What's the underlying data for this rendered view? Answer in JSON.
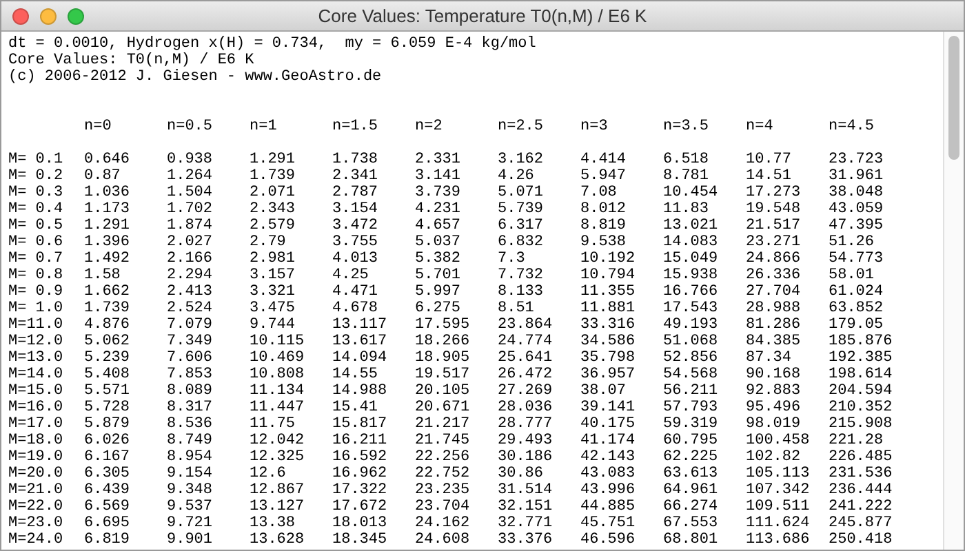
{
  "window": {
    "title": "Core Values: Temperature T0(n,M) / E6 K"
  },
  "header_lines": [
    "dt = 0.0010, Hydrogen x(H) = 0.734,  my = 6.059 E-4 kg/mol",
    "Core Values: T0(n,M) / E6 K",
    "(c) 2006-2012 J. Giesen - www.GeoAstro.de"
  ],
  "table": {
    "columns": [
      "n=0",
      "n=0.5",
      "n=1",
      "n=1.5",
      "n=2",
      "n=2.5",
      "n=3",
      "n=3.5",
      "n=4",
      "n=4.5"
    ],
    "rows": [
      {
        "label": "M= 0.1",
        "values": [
          "0.646",
          "0.938",
          "1.291",
          "1.738",
          "2.331",
          "3.162",
          "4.414",
          "6.518",
          "10.77",
          "23.723"
        ]
      },
      {
        "label": "M= 0.2",
        "values": [
          "0.87",
          "1.264",
          "1.739",
          "2.341",
          "3.141",
          "4.26",
          "5.947",
          "8.781",
          "14.51",
          "31.961"
        ]
      },
      {
        "label": "M= 0.3",
        "values": [
          "1.036",
          "1.504",
          "2.071",
          "2.787",
          "3.739",
          "5.071",
          "7.08",
          "10.454",
          "17.273",
          "38.048"
        ]
      },
      {
        "label": "M= 0.4",
        "values": [
          "1.173",
          "1.702",
          "2.343",
          "3.154",
          "4.231",
          "5.739",
          "8.012",
          "11.83",
          "19.548",
          "43.059"
        ]
      },
      {
        "label": "M= 0.5",
        "values": [
          "1.291",
          "1.874",
          "2.579",
          "3.472",
          "4.657",
          "6.317",
          "8.819",
          "13.021",
          "21.517",
          "47.395"
        ]
      },
      {
        "label": "M= 0.6",
        "values": [
          "1.396",
          "2.027",
          "2.79",
          "3.755",
          "5.037",
          "6.832",
          "9.538",
          "14.083",
          "23.271",
          "51.26"
        ]
      },
      {
        "label": "M= 0.7",
        "values": [
          "1.492",
          "2.166",
          "2.981",
          "4.013",
          "5.382",
          "7.3",
          "10.192",
          "15.049",
          "24.866",
          "54.773"
        ]
      },
      {
        "label": "M= 0.8",
        "values": [
          "1.58",
          "2.294",
          "3.157",
          "4.25",
          "5.701",
          "7.732",
          "10.794",
          "15.938",
          "26.336",
          "58.01"
        ]
      },
      {
        "label": "M= 0.9",
        "values": [
          "1.662",
          "2.413",
          "3.321",
          "4.471",
          "5.997",
          "8.133",
          "11.355",
          "16.766",
          "27.704",
          "61.024"
        ]
      },
      {
        "label": "M= 1.0",
        "values": [
          "1.739",
          "2.524",
          "3.475",
          "4.678",
          "6.275",
          "8.51",
          "11.881",
          "17.543",
          "28.988",
          "63.852"
        ]
      },
      {
        "label": "M=11.0",
        "values": [
          "4.876",
          "7.079",
          "9.744",
          "13.117",
          "17.595",
          "23.864",
          "33.316",
          "49.193",
          "81.286",
          "179.05"
        ]
      },
      {
        "label": "M=12.0",
        "values": [
          "5.062",
          "7.349",
          "10.115",
          "13.617",
          "18.266",
          "24.774",
          "34.586",
          "51.068",
          "84.385",
          "185.876"
        ]
      },
      {
        "label": "M=13.0",
        "values": [
          "5.239",
          "7.606",
          "10.469",
          "14.094",
          "18.905",
          "25.641",
          "35.798",
          "52.856",
          "87.34",
          "192.385"
        ]
      },
      {
        "label": "M=14.0",
        "values": [
          "5.408",
          "7.853",
          "10.808",
          "14.55",
          "19.517",
          "26.472",
          "36.957",
          "54.568",
          "90.168",
          "198.614"
        ]
      },
      {
        "label": "M=15.0",
        "values": [
          "5.571",
          "8.089",
          "11.134",
          "14.988",
          "20.105",
          "27.269",
          "38.07",
          "56.211",
          "92.883",
          "204.594"
        ]
      },
      {
        "label": "M=16.0",
        "values": [
          "5.728",
          "8.317",
          "11.447",
          "15.41",
          "20.671",
          "28.036",
          "39.141",
          "57.793",
          "95.496",
          "210.352"
        ]
      },
      {
        "label": "M=17.0",
        "values": [
          "5.879",
          "8.536",
          "11.75",
          "15.817",
          "21.217",
          "28.777",
          "40.175",
          "59.319",
          "98.019",
          "215.908"
        ]
      },
      {
        "label": "M=18.0",
        "values": [
          "6.026",
          "8.749",
          "12.042",
          "16.211",
          "21.745",
          "29.493",
          "41.174",
          "60.795",
          "100.458",
          "221.28"
        ]
      },
      {
        "label": "M=19.0",
        "values": [
          "6.167",
          "8.954",
          "12.325",
          "16.592",
          "22.256",
          "30.186",
          "42.143",
          "62.225",
          "102.82",
          "226.485"
        ]
      },
      {
        "label": "M=20.0",
        "values": [
          "6.305",
          "9.154",
          "12.6",
          "16.962",
          "22.752",
          "30.86",
          "43.083",
          "63.613",
          "105.113",
          "231.536"
        ]
      },
      {
        "label": "M=21.0",
        "values": [
          "6.439",
          "9.348",
          "12.867",
          "17.322",
          "23.235",
          "31.514",
          "43.996",
          "64.961",
          "107.342",
          "236.444"
        ]
      },
      {
        "label": "M=22.0",
        "values": [
          "6.569",
          "9.537",
          "13.127",
          "17.672",
          "23.704",
          "32.151",
          "44.885",
          "66.274",
          "109.511",
          "241.222"
        ]
      },
      {
        "label": "M=23.0",
        "values": [
          "6.695",
          "9.721",
          "13.38",
          "18.013",
          "24.162",
          "32.771",
          "45.751",
          "67.553",
          "111.624",
          "245.877"
        ]
      },
      {
        "label": "M=24.0",
        "values": [
          "6.819",
          "9.901",
          "13.628",
          "18.345",
          "24.608",
          "33.376",
          "46.596",
          "68.801",
          "113.686",
          "250.418"
        ]
      }
    ]
  }
}
